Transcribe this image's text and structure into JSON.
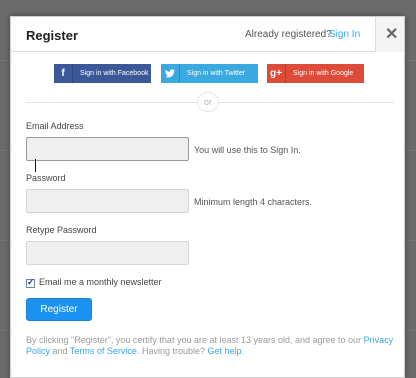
{
  "header": {
    "title": "Register",
    "already_text": "Already registered?",
    "signin_link": "Sign In",
    "close_glyph": "✕"
  },
  "social": {
    "facebook": {
      "icon": "f",
      "label": "Sign in with Facebook",
      "color": "#3b5998"
    },
    "twitter": {
      "icon": "🐦",
      "label": "Sign in with Twitter",
      "color": "#39a9e0"
    },
    "google": {
      "icon": "g+",
      "label": "Sign in with Google",
      "color": "#dd4b39"
    }
  },
  "divider_text": "or",
  "form": {
    "email_label": "Email Address",
    "email_value": "",
    "email_hint": "You will use this to Sign In.",
    "password_label": "Password",
    "password_value": "",
    "password_hint": "Minimum length 4 characters.",
    "retype_label": "Retype Password",
    "retype_value": "",
    "newsletter_label": "Email me a monthly newsletter",
    "newsletter_checked": true,
    "register_button": "Register"
  },
  "terms": {
    "part1": "By clicking \"Register\", you certify that you are at least 13 years old, and agree to our",
    "privacy_link": "Privacy Policy",
    "and_text": "and",
    "tos_link": "Terms of Service",
    "trouble_text": ". Having trouble?",
    "help_link": "Get help",
    "end_text": "."
  },
  "colors": {
    "accent": "#1b92f0",
    "link": "#3aa6e6"
  }
}
